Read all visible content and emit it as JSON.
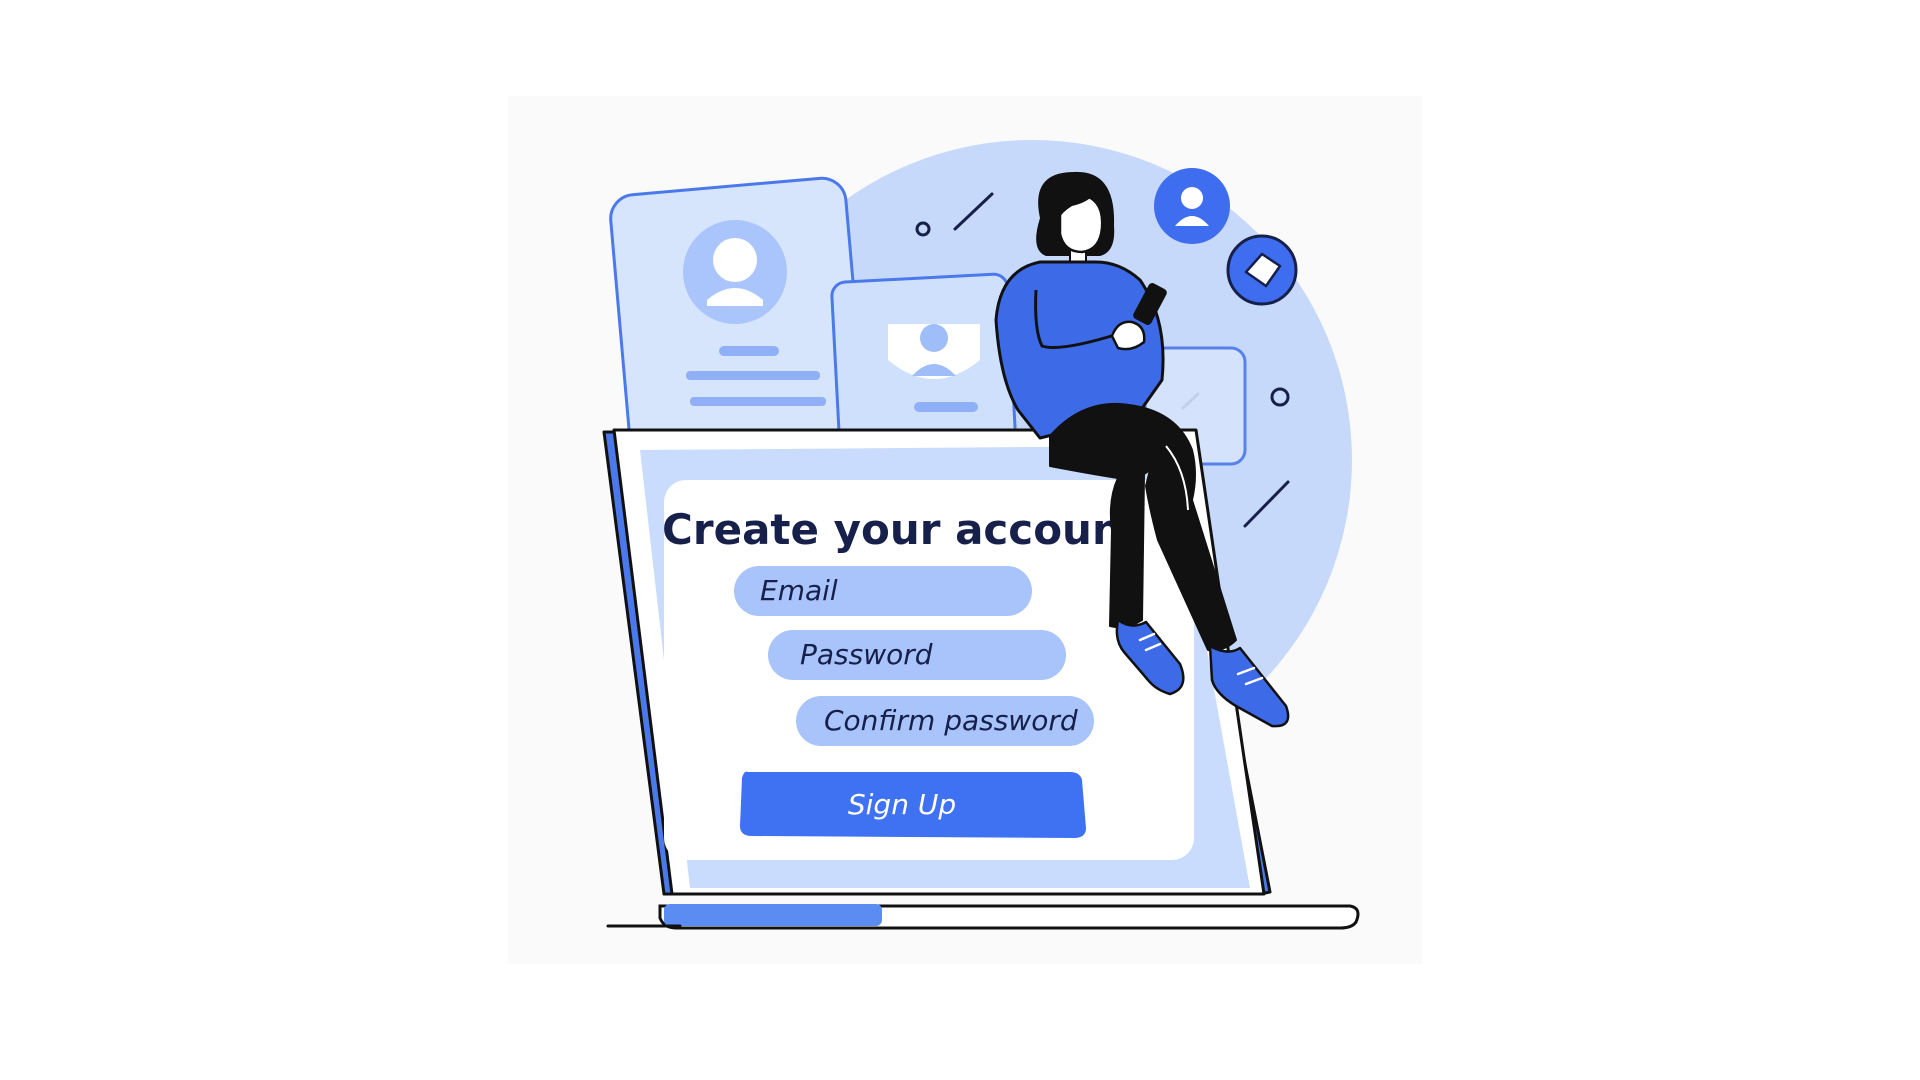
{
  "form": {
    "title": "Create your account",
    "email_placeholder": "Email",
    "password_placeholder": "Password",
    "confirm_placeholder": "Confirm password",
    "submit_label": "Sign Up"
  },
  "icons": [
    "user-icon",
    "ticket-icon",
    "avatar-icon",
    "phone-icon"
  ],
  "colors": {
    "accent": "#3f72f2",
    "field": "#a8c4fb",
    "panel": "#c9dcfd",
    "circle": "#c6d9fb",
    "ink": "#16204a",
    "shirt": "#3d6be8"
  }
}
